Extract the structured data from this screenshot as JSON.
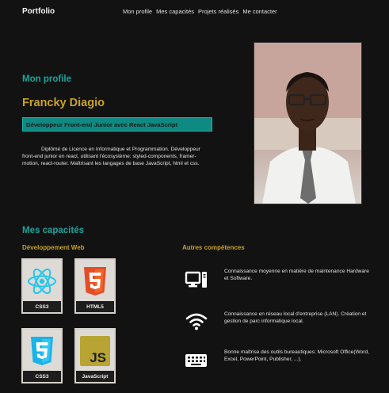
{
  "header": {
    "brand": "Portfolio",
    "nav": [
      "Mon profile",
      "Mes capacités",
      "Projets réalisés",
      "Me contacter"
    ]
  },
  "profile": {
    "section_title": "Mon profile",
    "name": "Francky Diagio",
    "role": "Développeur Front-end Junior avec React JavaScript",
    "bio": "Diplômé de Licence en Informatique et Programmation. Développeur front-end junior en react, utilisant l'écosystème: styled-components, framer-motion, react-router. Maîtrisant les langages de base JavaScript, html et css."
  },
  "capacities": {
    "section_title": "Mes capacités",
    "web_title": "Développement Web",
    "skills": [
      {
        "label": "CSS3",
        "icon": "react-icon"
      },
      {
        "label": "HTML5",
        "icon": "html5-icon"
      },
      {
        "label": "CSS3",
        "icon": "css3-icon"
      },
      {
        "label": "JavaScript",
        "icon": "javascript-icon"
      }
    ],
    "other_title": "Autres compétences",
    "others": [
      {
        "icon": "computer-icon",
        "text": "Connaissance moyenne en matière de maintenance Hardware et Software."
      },
      {
        "icon": "wifi-icon",
        "text": "Connaissance en réseau local d'entreprise (LAN). Création et gestion de parc informatique local."
      },
      {
        "icon": "keyboard-icon",
        "text": "Bonne maîtrise des outils bureautiques: Microsoft Office(Word, Excel, PowerPoint, Publisher, ...)."
      }
    ]
  },
  "colors": {
    "accent_teal": "#1aa39b",
    "accent_gold": "#c9a227",
    "background": "#121212"
  }
}
